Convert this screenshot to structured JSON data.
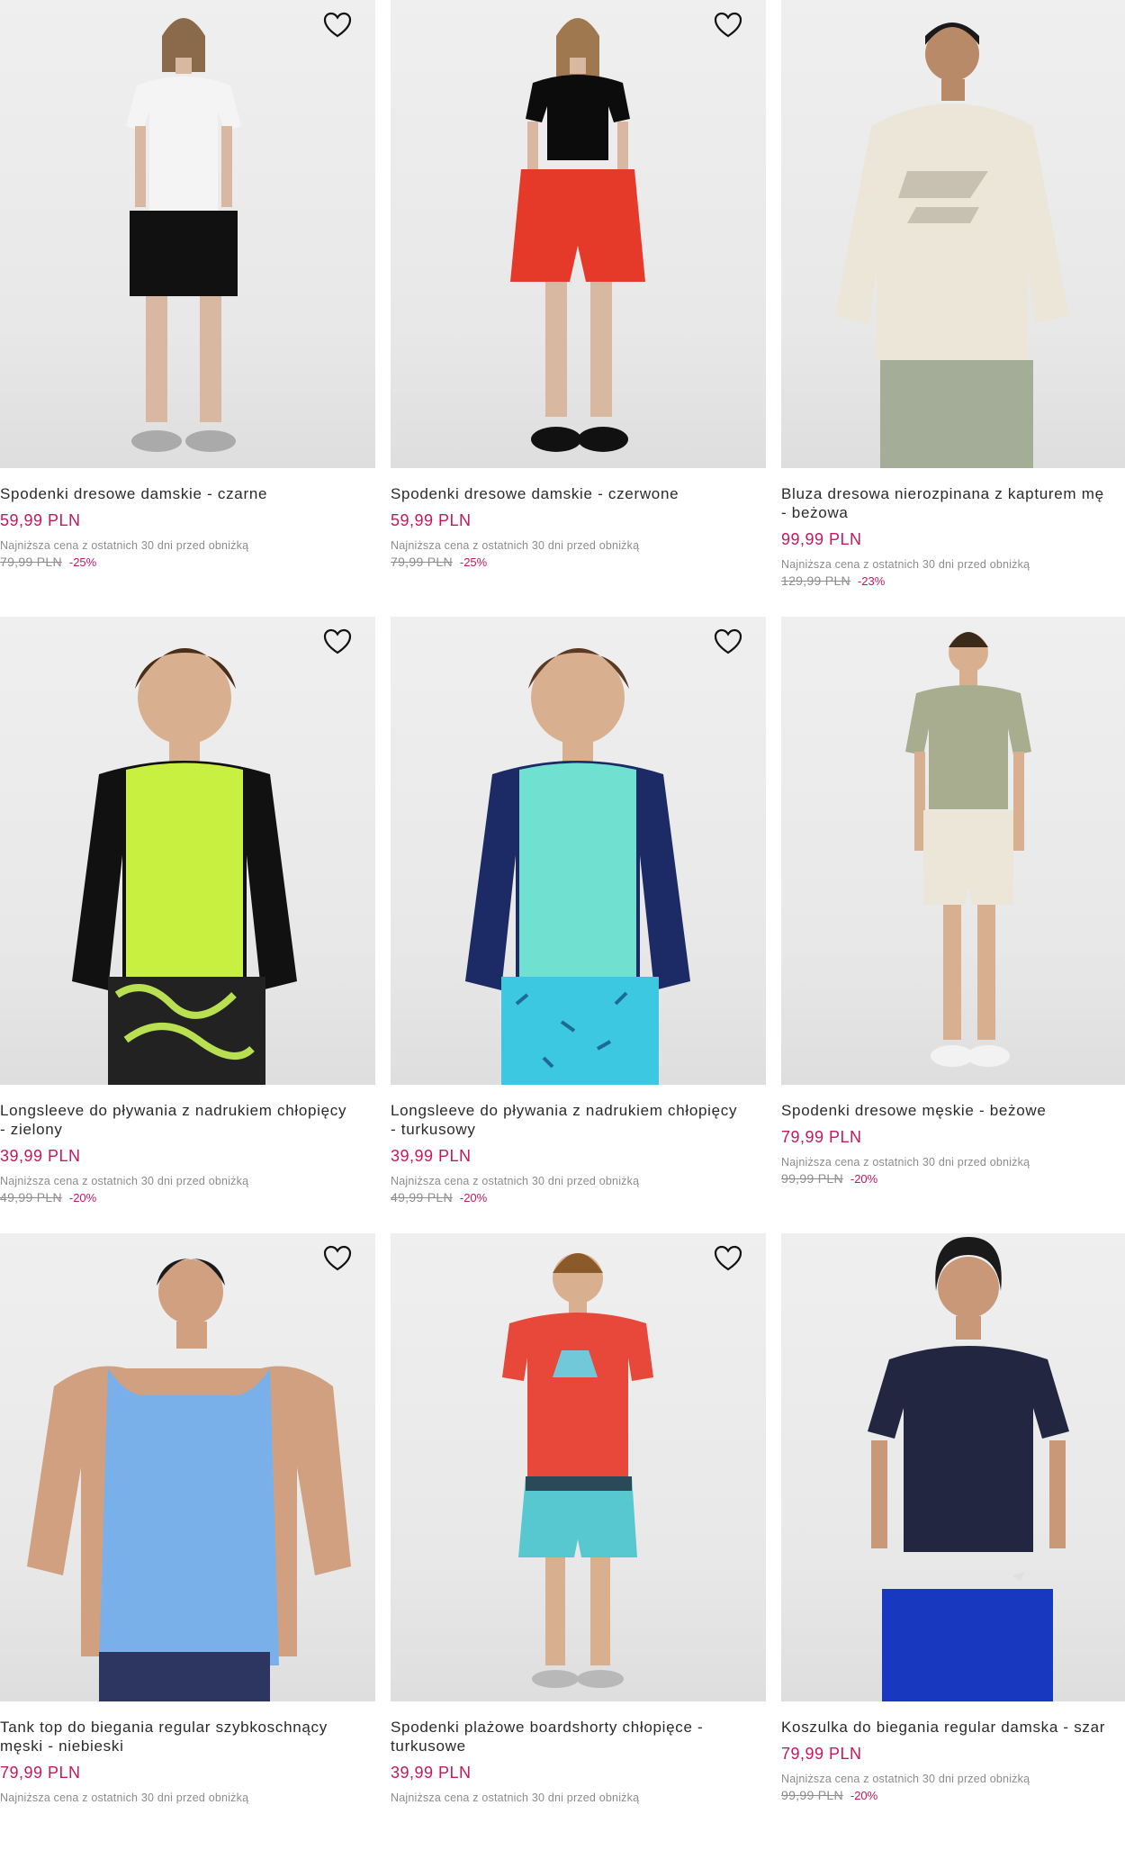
{
  "favorite_icon": "heart-outline-icon",
  "colors": {
    "price": "#c4185f",
    "muted": "#8c8c8c",
    "image_bg": "#ebebeb"
  },
  "products": [
    {
      "title": "Spodenki dresowe damskie - czarne",
      "price": "59,99 PLN",
      "lowest_label": "Najniższa cena z ostatnich 30 dni przed obniżką",
      "old_price": "79,99 PLN",
      "discount": "-25%"
    },
    {
      "title": "Spodenki dresowe damskie - czerwone",
      "price": "59,99 PLN",
      "lowest_label": "Najniższa cena z ostatnich 30 dni przed obniżką",
      "old_price": "79,99 PLN",
      "discount": "-25%"
    },
    {
      "title": "Bluza dresowa nierozpinana z kapturem mę\n- beżowa",
      "price": "99,99 PLN",
      "lowest_label": "Najniższa cena z ostatnich 30 dni przed obniżką",
      "old_price": "129,99 PLN",
      "discount": "-23%"
    },
    {
      "title": "Longsleeve do pływania z nadrukiem chłopięcy\n- zielony",
      "price": "39,99 PLN",
      "lowest_label": "Najniższa cena z ostatnich 30 dni przed obniżką",
      "old_price": "49,99 PLN",
      "discount": "-20%"
    },
    {
      "title": "Longsleeve do pływania z nadrukiem chłopięcy\n- turkusowy",
      "price": "39,99 PLN",
      "lowest_label": "Najniższa cena z ostatnich 30 dni przed obniżką",
      "old_price": "49,99 PLN",
      "discount": "-20%"
    },
    {
      "title": "Spodenki dresowe męskie - beżowe",
      "price": "79,99 PLN",
      "lowest_label": "Najniższa cena z ostatnich 30 dni przed obniżką",
      "old_price": "99,99 PLN",
      "discount": "-20%"
    },
    {
      "title": "Tank top do biegania regular szybkoschnący\nmęski - niebieski",
      "price": "79,99 PLN",
      "lowest_label": "Najniższa cena z ostatnich 30 dni przed obniżką",
      "old_price": "",
      "discount": ""
    },
    {
      "title": "Spodenki plażowe boardshorty chłopięce -\nturkusowe",
      "price": "39,99 PLN",
      "lowest_label": "Najniższa cena z ostatnich 30 dni przed obniżką",
      "old_price": "",
      "discount": ""
    },
    {
      "title": "Koszulka do biegania regular damska - szar",
      "price": "79,99 PLN",
      "lowest_label": "Najniższa cena z ostatnich 30 dni przed obniżką",
      "old_price": "99,99 PLN",
      "discount": "-20%"
    }
  ]
}
